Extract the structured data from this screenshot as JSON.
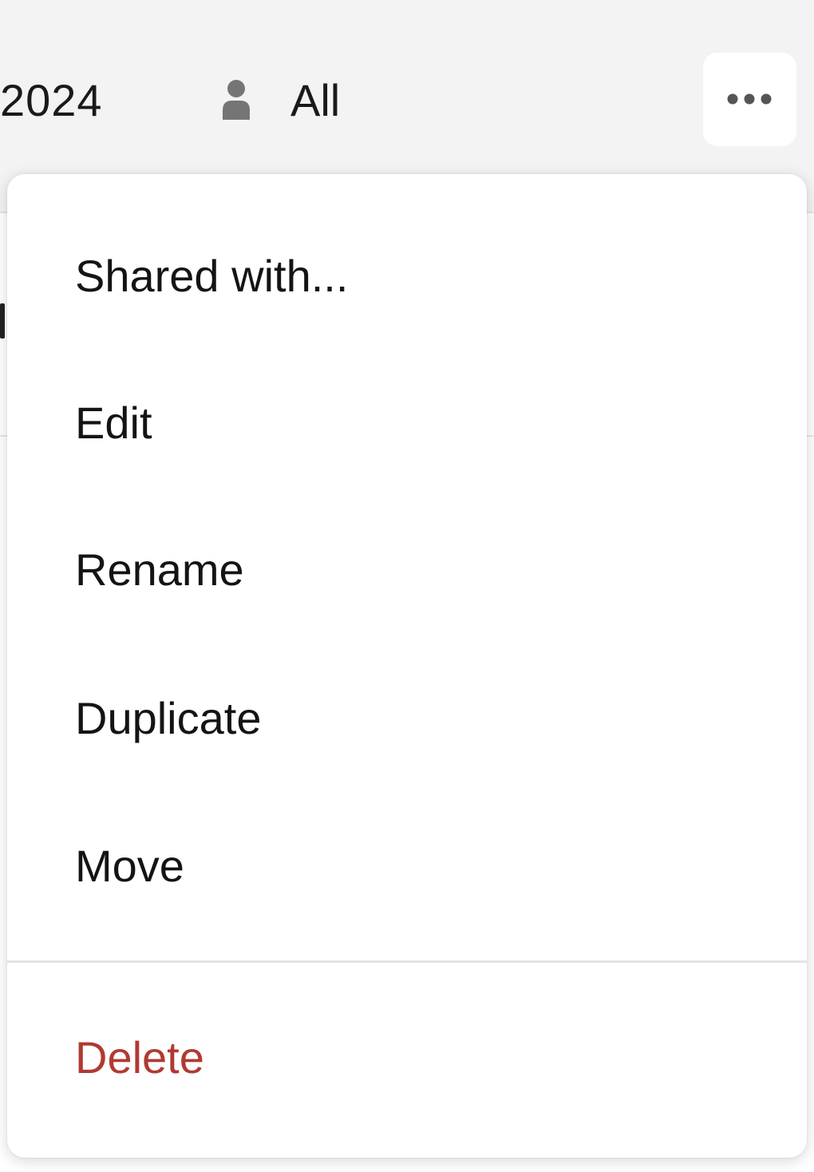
{
  "header": {
    "date_text": "2024",
    "filter_icon": "person-icon",
    "filter_label": "All",
    "more_icon": "more-horizontal-icon"
  },
  "menu": {
    "items": [
      {
        "label": "Shared with..."
      },
      {
        "label": "Edit"
      },
      {
        "label": "Rename"
      },
      {
        "label": "Duplicate"
      },
      {
        "label": "Move"
      }
    ],
    "delete_label": "Delete"
  },
  "colors": {
    "header_bg": "#f3f3f3",
    "text": "#141414",
    "danger": "#b03a32",
    "icon_gray": "#757575"
  }
}
